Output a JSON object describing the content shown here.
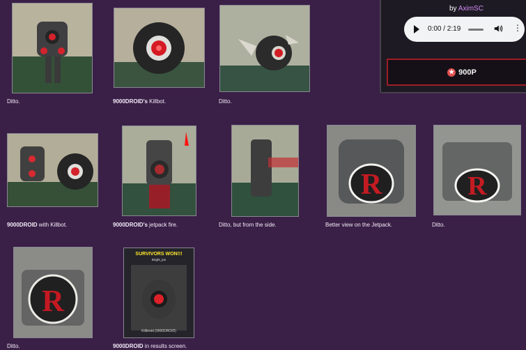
{
  "captions": [
    {
      "bold": "",
      "text": "Ditto."
    },
    {
      "bold": "9000DROID's",
      "text": " Killbot."
    },
    {
      "bold": "",
      "text": "Ditto."
    },
    {
      "bold": "9000DROID",
      "text": " with Killbot."
    },
    {
      "bold": "9000DROID's",
      "text": " jetpack fire."
    },
    {
      "bold": "",
      "text": "Ditto, but from the side."
    },
    {
      "bold": "",
      "text": "Better view on the Jetpack."
    },
    {
      "bold": "",
      "text": "Ditto."
    },
    {
      "bold": "",
      "text": "Ditto."
    },
    {
      "bold": "9000DROID",
      "text": " in results screen."
    }
  ],
  "side_panel": {
    "by": "by",
    "author": "AximSC",
    "audio": {
      "time": "0:00 / 2:19",
      "more": "⋮"
    },
    "price": "900P",
    "price_icon": "★"
  },
  "results_screen": {
    "title": "SURVIVORS WON!!!",
    "subtitle": "Bright_joe",
    "footer": "Killbroid (9000DROID)"
  }
}
